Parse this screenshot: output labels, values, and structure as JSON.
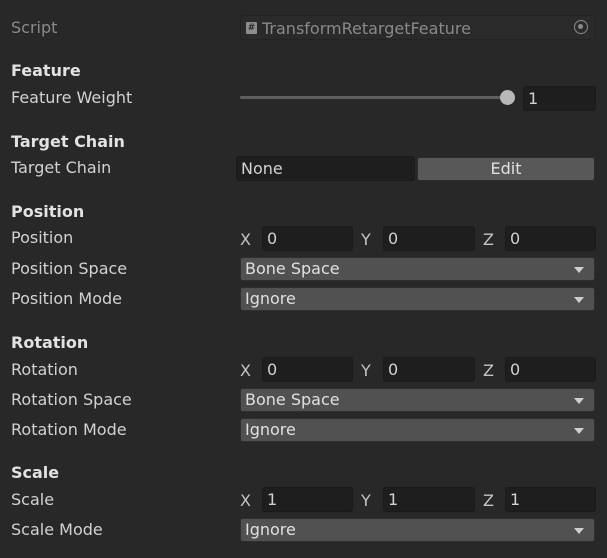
{
  "script": {
    "label": "Script",
    "value": "TransformRetargetFeature",
    "hash_glyph": "#"
  },
  "feature": {
    "header": "Feature",
    "weight_label": "Feature Weight",
    "weight_value": "1",
    "weight_fraction": 1.0
  },
  "target_chain": {
    "header": "Target Chain",
    "label": "Target Chain",
    "value": "None",
    "edit_label": "Edit"
  },
  "position": {
    "header": "Position",
    "label": "Position",
    "x_label": "X",
    "x": "0",
    "y_label": "Y",
    "y": "0",
    "z_label": "Z",
    "z": "0",
    "space_label": "Position Space",
    "space_value": "Bone Space",
    "mode_label": "Position Mode",
    "mode_value": "Ignore"
  },
  "rotation": {
    "header": "Rotation",
    "label": "Rotation",
    "x_label": "X",
    "x": "0",
    "y_label": "Y",
    "y": "0",
    "z_label": "Z",
    "z": "0",
    "space_label": "Rotation Space",
    "space_value": "Bone Space",
    "mode_label": "Rotation Mode",
    "mode_value": "Ignore"
  },
  "scale": {
    "header": "Scale",
    "label": "Scale",
    "x_label": "X",
    "x": "1",
    "y_label": "Y",
    "y": "1",
    "z_label": "Z",
    "z": "1",
    "mode_label": "Scale Mode",
    "mode_value": "Ignore"
  },
  "icons": {
    "script": "script-file-icon",
    "picker": "object-picker-icon",
    "dropdown": "chevron-down-icon"
  },
  "colors": {
    "background": "#282828",
    "field": "#1e1e1e",
    "dropdown": "#515151",
    "button": "#585858"
  }
}
